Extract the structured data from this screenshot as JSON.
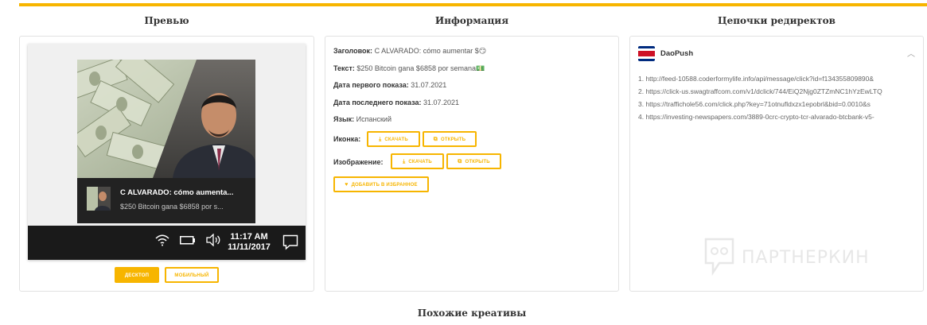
{
  "sections": {
    "preview_title": "Превью",
    "info_title": "Информация",
    "redirects_title": "Цепочки редиректов",
    "similar_title": "Похожие креативы"
  },
  "notification": {
    "title": "C ALVARADO: cómo aumenta...",
    "text": "$250 Bitcoin gana $6858 por s..."
  },
  "taskbar": {
    "time": "11:17 AM",
    "date": "11/11/2017",
    "icons": [
      "wifi-icon",
      "battery-icon",
      "volume-icon",
      "notification-icon"
    ]
  },
  "preview_buttons": {
    "desktop": "десктоп",
    "mobile": "мобильный"
  },
  "info": {
    "heading_label": "Заголовок:",
    "heading_value": "C ALVARADO: cómo aumentar $😏",
    "text_label": "Текст:",
    "text_value": "$250 Bitcoin gana $6858 por semana💵",
    "first_shown_label": "Дата первого показа:",
    "first_shown_value": "31.07.2021",
    "last_shown_label": "Дата последнего показа:",
    "last_shown_value": "31.07.2021",
    "language_label": "Язык:",
    "language_value": "Испанский",
    "icon_label": "Иконка:",
    "image_label": "Изображение:",
    "download": "скачать",
    "open": "открыть",
    "favorite": "добавить в избранное"
  },
  "redirects": {
    "network": "DaoPush",
    "items": [
      "1. http://feed-10588.coderformylife.info/api/message/click?id=f134355809890&",
      "2. https://click-us.swagtraffcom.com/v1/dclick/744/EiQ2Njg0ZTZmNC1hYzEwLTQ",
      "3. https://traffichole56.com/click.php?key=71otnufldxzx1epobrl&bid=0.0010&s",
      "4. https://investing-newspapers.com/3889-0crc-crypto-tcr-alvarado-btcbank-v5-"
    ]
  },
  "watermark": "ПАРТНЕРКИН",
  "colors": {
    "accent": "#f7b500",
    "dark": "#1a1a1a",
    "border": "#e2e2e2"
  }
}
